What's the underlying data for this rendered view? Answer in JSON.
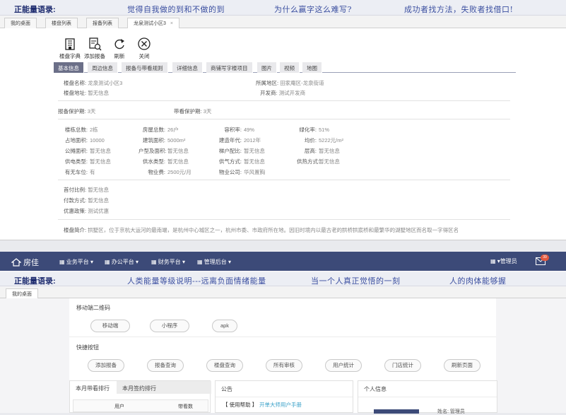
{
  "top": {
    "energy": {
      "label": "正能量语录:",
      "messages": [
        "觉得自我做的到和不做的到",
        "为什么赢字这么难写?",
        "成功者找方法，失败者找借口!"
      ]
    },
    "tabs": [
      {
        "label": "我的桌面"
      },
      {
        "label": "楼盘列表"
      },
      {
        "label": "报备列表"
      },
      {
        "label": "龙泉测试小区3",
        "close": "×"
      }
    ],
    "toolbar": [
      {
        "label": "楼盘字典",
        "icon": "building-dictionary-icon"
      },
      {
        "label": "添加报备",
        "icon": "add-report-icon"
      },
      {
        "label": "刷新",
        "icon": "refresh-icon"
      },
      {
        "label": "关闭",
        "icon": "close-icon"
      }
    ],
    "detail_tabs": [
      "基本信息",
      "周边信息",
      "报备与带看规则",
      "详细信息",
      "商铺写字楼项目",
      "图片",
      "视频",
      "地图"
    ],
    "basic": {
      "name_label": "楼盘名称:",
      "name_value": "龙泉测试小区3",
      "region_label": "所属地区:",
      "region_value": "田家庵区-龙泉街道",
      "address_label": "楼盘地址:",
      "address_value": "暂无信息",
      "developer_label": "开发商:",
      "developer_value": "测试开发商",
      "report_protect_label": "报备保护期:",
      "report_protect_value": "3天",
      "visit_protect_label": "带看保护期:",
      "visit_protect_value": "3天"
    },
    "grid": [
      [
        {
          "k": "楼栋总数:",
          "v": "2栋"
        },
        {
          "k": "房屋总数:",
          "v": "26户"
        },
        {
          "k": "容积率:",
          "v": "49%"
        },
        {
          "k": "绿化率:",
          "v": "51%"
        }
      ],
      [
        {
          "k": "占地面积:",
          "v": "10000"
        },
        {
          "k": "建筑面积:",
          "v": "5000m²"
        },
        {
          "k": "建造年代:",
          "v": "2012年"
        },
        {
          "k": "均价:",
          "v": "5222元/m²"
        }
      ],
      [
        {
          "k": "公摊面积:",
          "v": "暂无信息"
        },
        {
          "k": "户型及面积:",
          "v": "暂无信息"
        },
        {
          "k": "梯户配比:",
          "v": "暂无信息"
        },
        {
          "k": "层高:",
          "v": "暂无信息"
        }
      ],
      [
        {
          "k": "供电类型:",
          "v": "暂无信息"
        },
        {
          "k": "供水类型:",
          "v": "暂无信息"
        },
        {
          "k": "供气方式:",
          "v": "暂无信息"
        },
        {
          "k": "供热方式:",
          "v": "暂无信息"
        }
      ],
      [
        {
          "k": "有无车位:",
          "v": "有"
        },
        {
          "k": "物业费:",
          "v": "2500元/月"
        },
        {
          "k": "物业公司:",
          "v": "华风置胸"
        }
      ]
    ],
    "pay": [
      {
        "k": "首付比例:",
        "v": "暂无信息"
      },
      {
        "k": "付款方式:",
        "v": "暂无信息"
      },
      {
        "k": "优惠政策:",
        "v": "测试优惠"
      }
    ],
    "intro_label": "楼盘简介:",
    "intro_value": "拱墅区，位于京杭大运河的最南端，是杭州中心城区之一，杭州市委、市政府所在地。因旧时境内以最古老的拱桥拱宸桥和最繁华的湖墅地区而名取一字得区名"
  },
  "bottom": {
    "navbar": {
      "logo": "房佳",
      "menus": [
        "业务平台",
        "办公平台",
        "财务平台",
        "管理后台"
      ],
      "user": "管理员",
      "badge": "39"
    },
    "energy": {
      "label": "正能量语录:",
      "messages": [
        "人类能量等级说明---远离负面情绪能量",
        "当一个人真正觉悟的一刻",
        "人的肉体能够握"
      ]
    },
    "tab": "我的桌面",
    "qr_title": "移动端二维码",
    "qr_buttons": [
      "移动端",
      "小程序",
      "apk"
    ],
    "quick_title": "快捷按钮",
    "quick_buttons": [
      "添加报备",
      "报备查询",
      "楼盘查询",
      "所有审核",
      "用户统计",
      "门店统计",
      "刷新页面"
    ],
    "rank_tabs": [
      "本月带看排行",
      "本月签约排行"
    ],
    "rank_cols": [
      "用户",
      "带看数"
    ],
    "notice_title": "公告",
    "notice_tag": "【 使用帮助 】",
    "notice_link": "开单大师用户手册",
    "profile_title": "个人信息",
    "profile_name_label": "姓名:",
    "profile_name_value": "管理员"
  }
}
